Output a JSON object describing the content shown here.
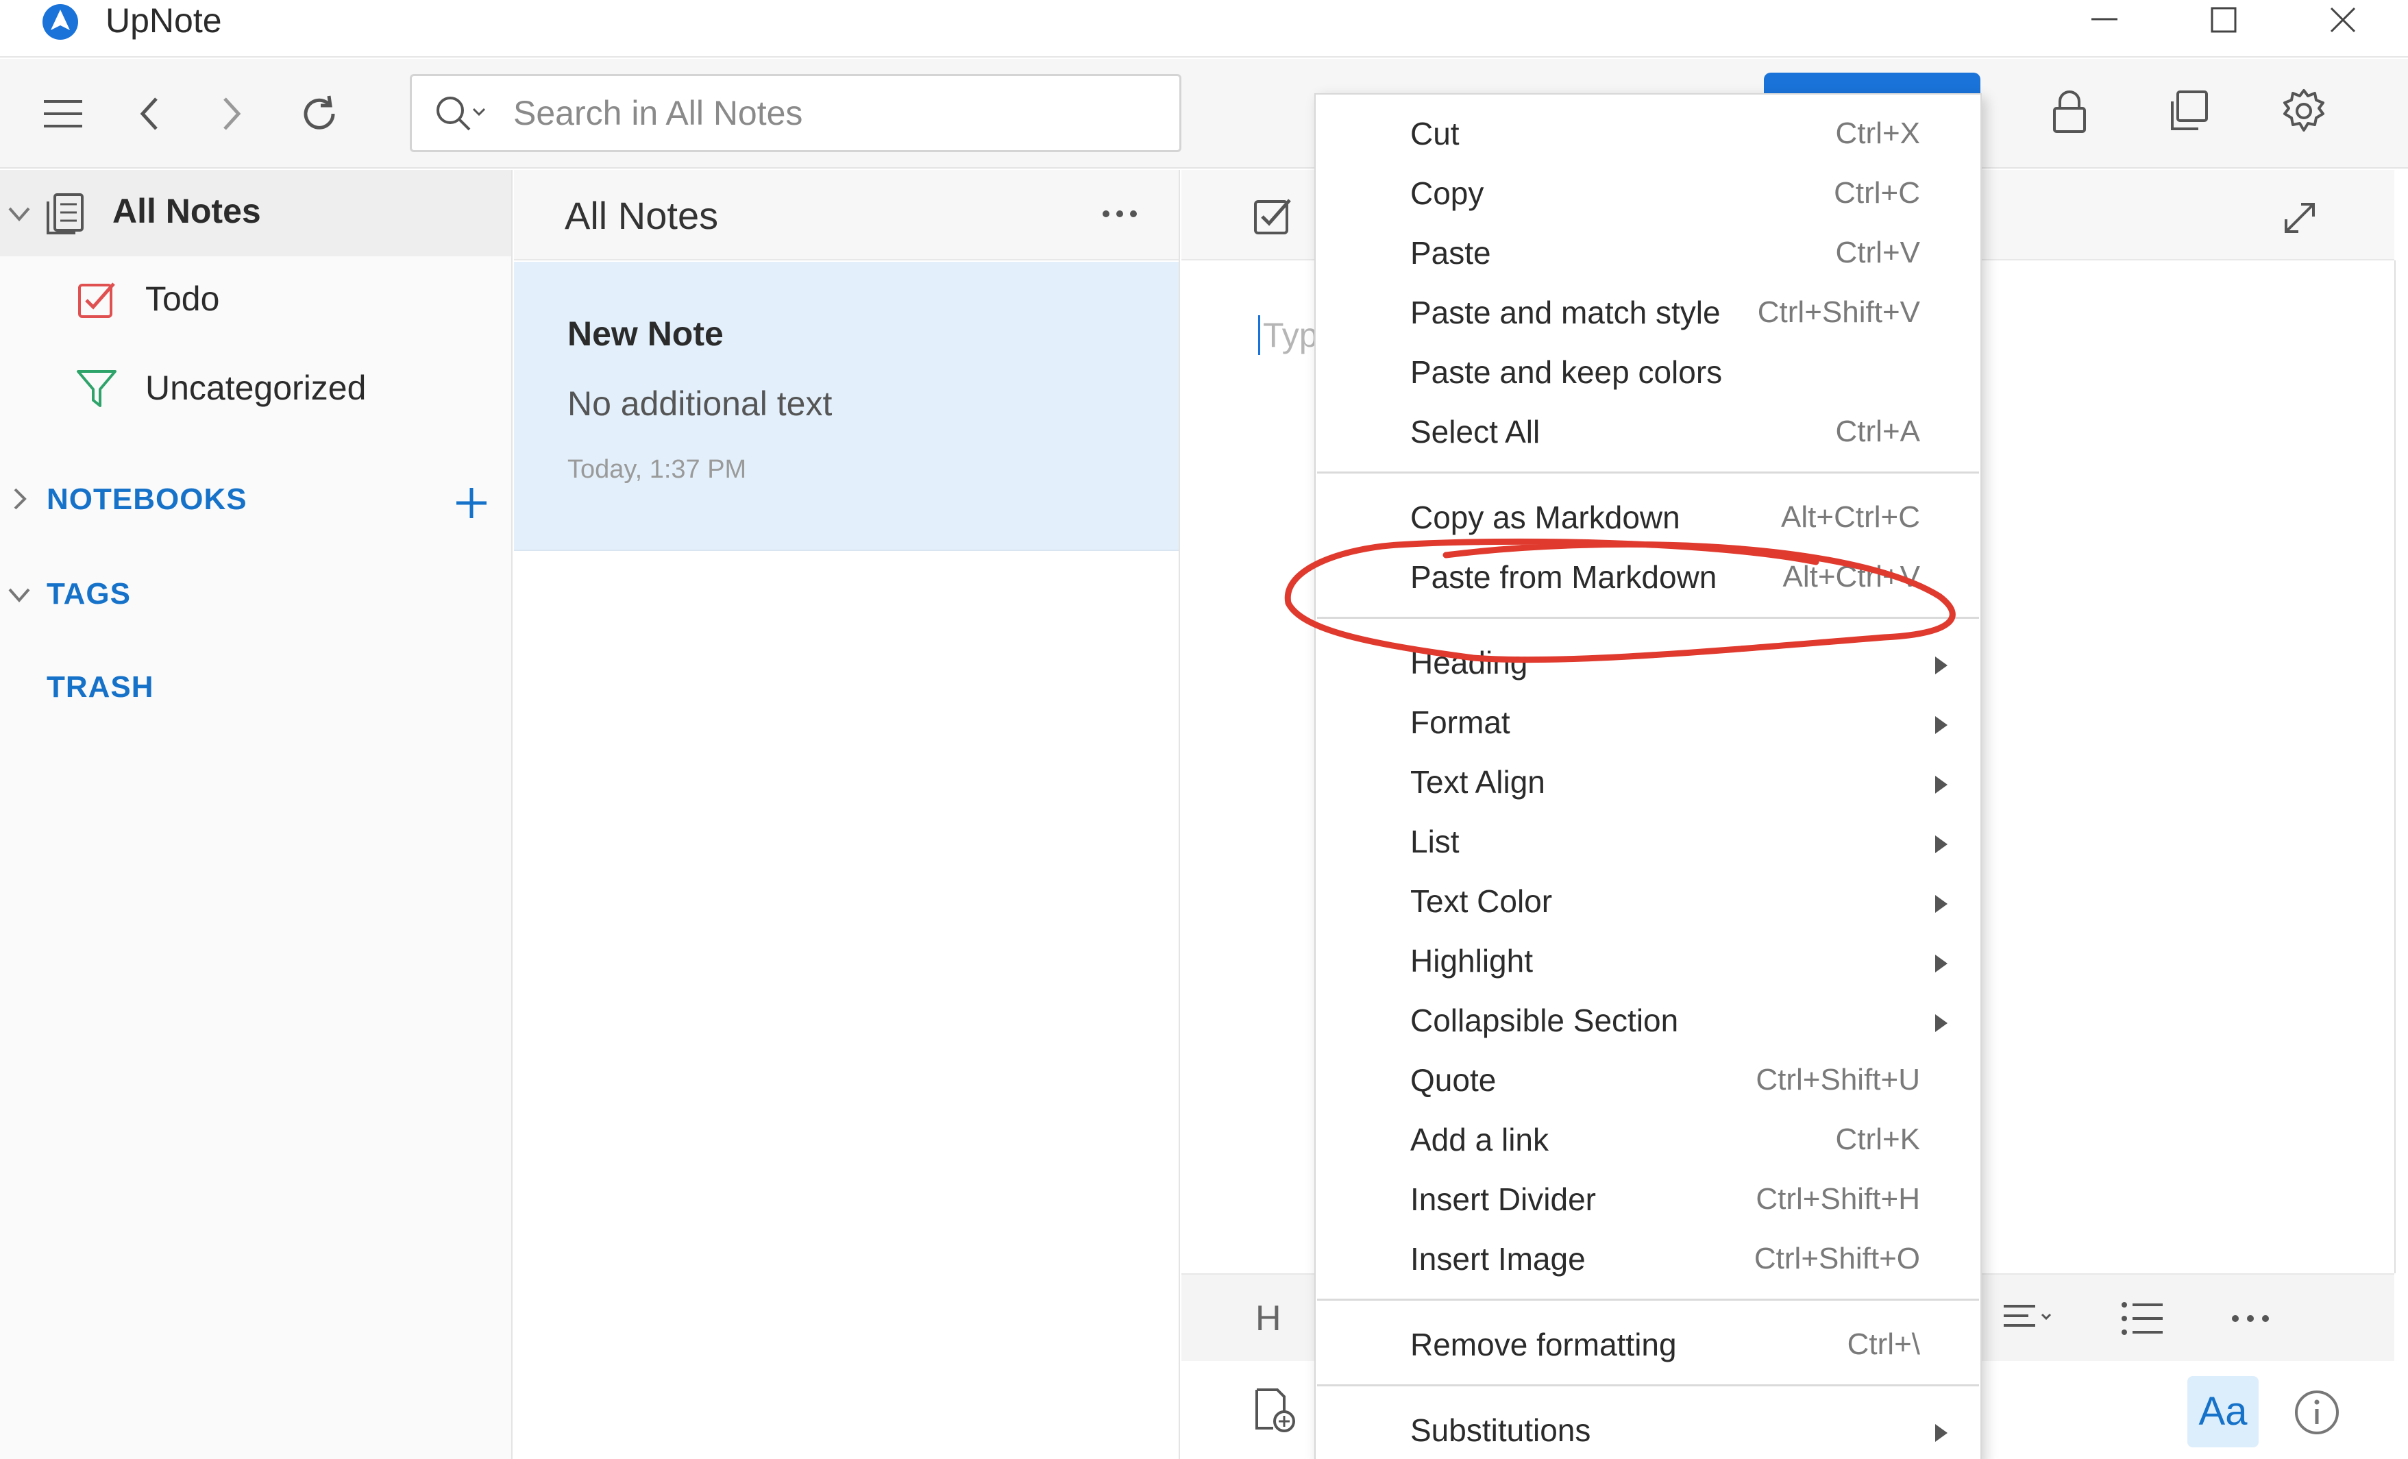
{
  "app": {
    "title": "UpNote",
    "accent_color": "#1a73d9",
    "section_color": "#1672c9"
  },
  "toolbar": {
    "menu_icon": "hamburger-icon",
    "back_icon": "chevron-left-icon",
    "forward_icon": "chevron-right-icon",
    "refresh_icon": "refresh-icon",
    "search_placeholder": "Search in All Notes",
    "lock_icon": "lock-icon",
    "duplicate_icon": "copy-window-icon",
    "settings_icon": "gear-icon"
  },
  "sidebar": {
    "all_notes": "All Notes",
    "todo": "Todo",
    "uncategorized": "Uncategorized",
    "notebooks": "NOTEBOOKS",
    "tags": "TAGS",
    "trash": "TRASH"
  },
  "notelist": {
    "title": "All Notes",
    "notes": [
      {
        "title": "New Note",
        "body": "No additional text",
        "date": "Today, 1:37 PM"
      }
    ]
  },
  "editor": {
    "placeholder": "Typ",
    "font_button": "Aa",
    "heading_button": "H"
  },
  "context_menu": {
    "items": [
      {
        "label": "Cut",
        "shortcut": "Ctrl+X"
      },
      {
        "label": "Copy",
        "shortcut": "Ctrl+C"
      },
      {
        "label": "Paste",
        "shortcut": "Ctrl+V"
      },
      {
        "label": "Paste and match style",
        "shortcut": "Ctrl+Shift+V"
      },
      {
        "label": "Paste and keep colors",
        "shortcut": ""
      },
      {
        "label": "Select All",
        "shortcut": "Ctrl+A"
      },
      {
        "label": "Copy as Markdown",
        "shortcut": "Alt+Ctrl+C"
      },
      {
        "label": "Paste from Markdown",
        "shortcut": "Alt+Ctrl+V"
      },
      {
        "label": "Heading",
        "shortcut": ""
      },
      {
        "label": "Format",
        "shortcut": ""
      },
      {
        "label": "Text Align",
        "shortcut": ""
      },
      {
        "label": "List",
        "shortcut": ""
      },
      {
        "label": "Text Color",
        "shortcut": ""
      },
      {
        "label": "Highlight",
        "shortcut": ""
      },
      {
        "label": "Collapsible Section",
        "shortcut": ""
      },
      {
        "label": "Quote",
        "shortcut": "Ctrl+Shift+U"
      },
      {
        "label": "Add a link",
        "shortcut": "Ctrl+K"
      },
      {
        "label": "Insert Divider",
        "shortcut": "Ctrl+Shift+H"
      },
      {
        "label": "Insert Image",
        "shortcut": "Ctrl+Shift+O"
      },
      {
        "label": "Remove formatting",
        "shortcut": "Ctrl+\\"
      },
      {
        "label": "Substitutions",
        "shortcut": ""
      }
    ]
  },
  "annotation_color": "#e03a2e"
}
